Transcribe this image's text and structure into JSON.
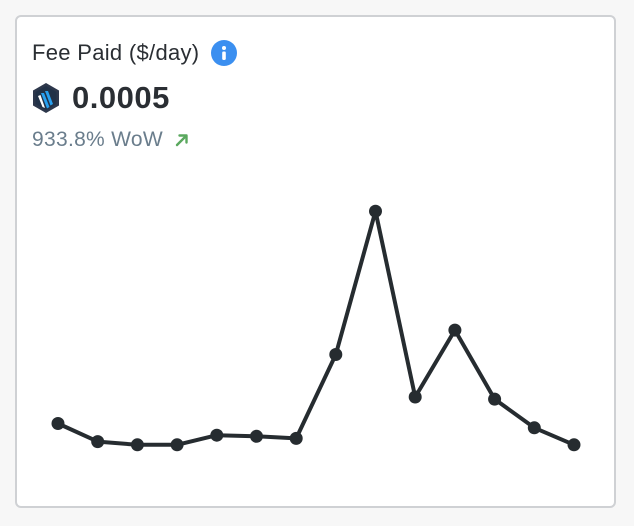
{
  "card": {
    "title": "Fee Paid ($/day)",
    "value": "0.0005",
    "change": "933.8% WoW",
    "info_icon": "info-icon",
    "token_icon": "arbitrum-logo-icon",
    "trend_icon": "arrow-up-right-icon"
  },
  "colors": {
    "line": "#262c30",
    "info": "#3b8ff0",
    "trend_up": "#5aa85e",
    "muted_text": "#6a7d8c"
  },
  "chart_data": {
    "type": "line",
    "values": [
      4e-05,
      2.3e-05,
      2e-05,
      2e-05,
      2.9e-05,
      2.8e-05,
      2.6e-05,
      0.000105,
      0.00024,
      6.5e-05,
      0.000128,
      6.3e-05,
      3.6e-05,
      2e-05
    ],
    "ylim": [
      0,
      0.00026
    ],
    "grid": false,
    "legend": "none"
  }
}
